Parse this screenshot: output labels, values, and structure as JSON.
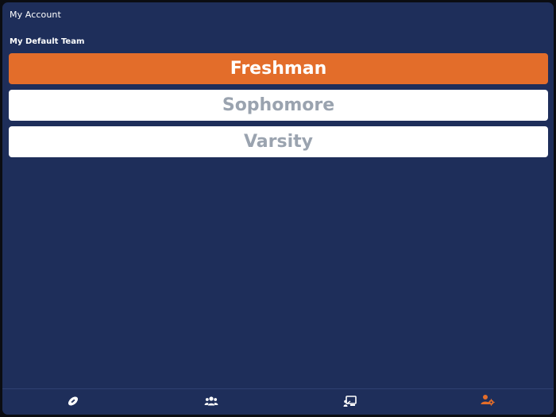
{
  "header": {
    "title": "My Account"
  },
  "section": {
    "label": "My Default Team"
  },
  "teams": [
    {
      "label": "Freshman",
      "selected": true
    },
    {
      "label": "Sophomore",
      "selected": false
    },
    {
      "label": "Varsity",
      "selected": false
    }
  ],
  "tabbar": {
    "items": [
      {
        "icon": "football-icon",
        "active": false
      },
      {
        "icon": "team-users-icon",
        "active": false
      },
      {
        "icon": "presentation-board-icon",
        "active": false
      },
      {
        "icon": "user-settings-icon",
        "active": true
      }
    ]
  },
  "colors": {
    "background": "#1e2e5a",
    "accent": "#e36d2a",
    "button_inactive_bg": "#ffffff",
    "button_inactive_text": "#9aa3af",
    "icon_inactive": "#ffffff"
  }
}
